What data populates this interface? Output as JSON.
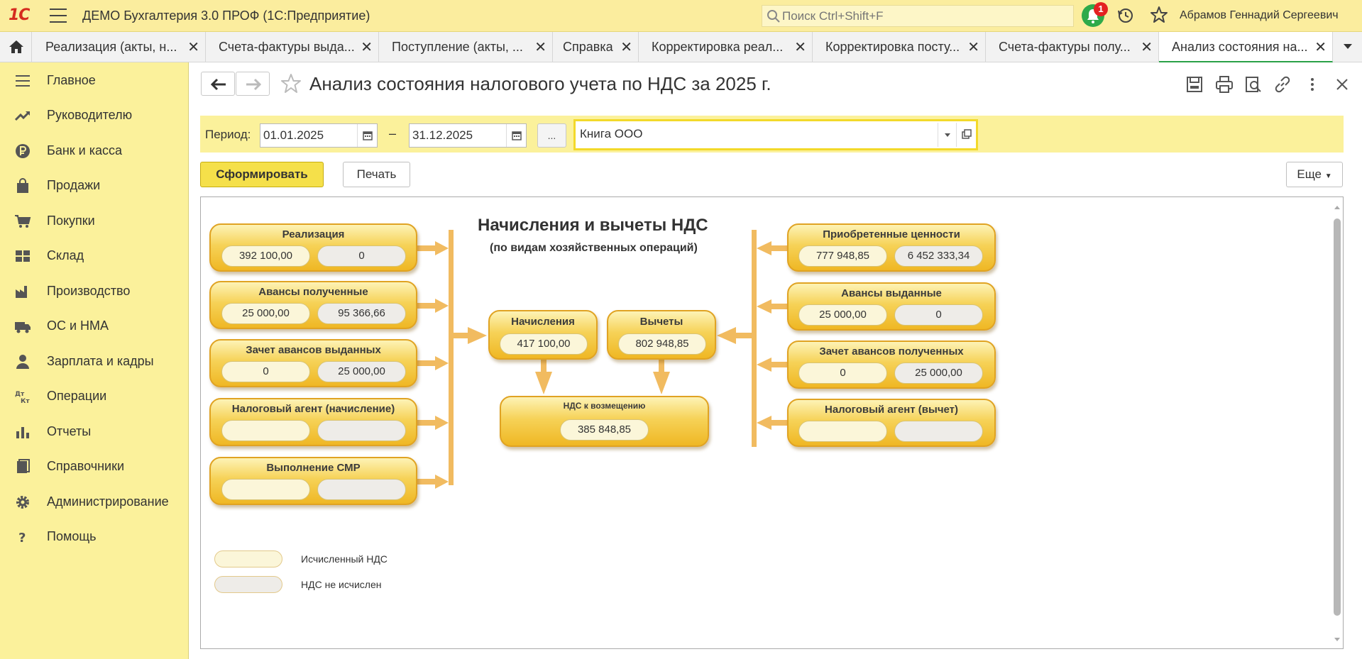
{
  "app": {
    "logo": "1С",
    "title": "ДЕМО Бухгалтерия 3.0 ПРОФ  (1С:Предприятие)",
    "search_placeholder": "Поиск Ctrl+Shift+F",
    "notifications_count": "1",
    "user_name": "Абрамов Геннадий Сергеевич"
  },
  "tabs": [
    {
      "label": "Реализация (акты, н..."
    },
    {
      "label": "Счета-фактуры выда..."
    },
    {
      "label": "Поступление (акты, ..."
    },
    {
      "label": "Справка"
    },
    {
      "label": "Корректировка реал..."
    },
    {
      "label": "Корректировка посту..."
    },
    {
      "label": "Счета-фактуры полу..."
    },
    {
      "label": "Анализ состояния на..."
    }
  ],
  "sidebar": {
    "items": [
      {
        "label": "Главное",
        "icon": "menu-icon"
      },
      {
        "label": "Руководителю",
        "icon": "trend-icon"
      },
      {
        "label": "Банк и касса",
        "icon": "ruble-icon"
      },
      {
        "label": "Продажи",
        "icon": "bag-icon"
      },
      {
        "label": "Покупки",
        "icon": "cart-icon"
      },
      {
        "label": "Склад",
        "icon": "warehouse-icon"
      },
      {
        "label": "Производство",
        "icon": "factory-icon"
      },
      {
        "label": "ОС и НМА",
        "icon": "truck-icon"
      },
      {
        "label": "Зарплата и кадры",
        "icon": "person-icon"
      },
      {
        "label": "Операции",
        "icon": "dt-kt-icon"
      },
      {
        "label": "Отчеты",
        "icon": "bar-chart-icon"
      },
      {
        "label": "Справочники",
        "icon": "books-icon"
      },
      {
        "label": "Администрирование",
        "icon": "gear-icon"
      },
      {
        "label": "Помощь",
        "icon": "question-icon"
      }
    ]
  },
  "form": {
    "title": "Анализ состояния налогового учета по НДС за 2025 г.",
    "period_label": "Период:",
    "date_from": "01.01.2025",
    "date_separator": "–",
    "date_to": "31.12.2025",
    "dots_label": "...",
    "book_value": "Книга ООО",
    "generate_label": "Сформировать",
    "print_label": "Печать",
    "more_label": "Еще"
  },
  "diagram": {
    "title": "Начисления и вычеты НДС",
    "subtitle": "(по видам хозяйственных операций)",
    "left_blocks": [
      {
        "title": "Реализация",
        "calc": "392 100,00",
        "not_calc": "0"
      },
      {
        "title": "Авансы полученные",
        "calc": "25 000,00",
        "not_calc": "95 366,66"
      },
      {
        "title": "Зачет авансов выданных",
        "calc": "0",
        "not_calc": "25 000,00"
      },
      {
        "title": "Налоговый агент (начисление)",
        "calc": "",
        "not_calc": ""
      },
      {
        "title": "Выполнение СМР",
        "calc": "",
        "not_calc": ""
      }
    ],
    "right_blocks": [
      {
        "title": "Приобретенные ценности",
        "calc": "777 948,85",
        "not_calc": "6 452 333,34"
      },
      {
        "title": "Авансы выданные",
        "calc": "25 000,00",
        "not_calc": "0"
      },
      {
        "title": "Зачет авансов полученных",
        "calc": "0",
        "not_calc": "25 000,00"
      },
      {
        "title": "Налоговый агент (вычет)",
        "calc": "",
        "not_calc": ""
      }
    ],
    "accruals": {
      "title": "Начисления",
      "value": "417 100,00"
    },
    "deductions": {
      "title": "Вычеты",
      "value": "802 948,85"
    },
    "refund": {
      "title": "НДС к возмещению",
      "value": "385 848,85"
    },
    "legend": {
      "calc": "Исчисленный НДС",
      "not_calc": "НДС не исчислен"
    }
  }
}
